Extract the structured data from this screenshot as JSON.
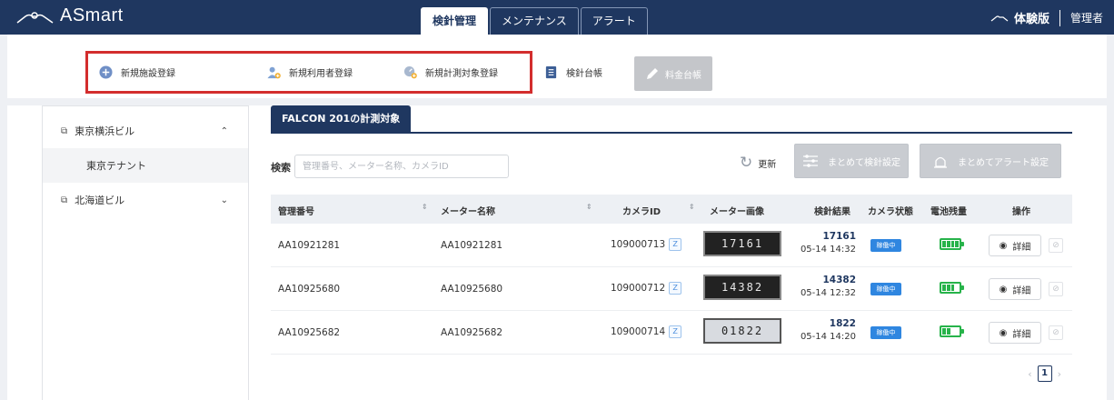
{
  "header": {
    "brand": "ASmart",
    "tabs": [
      {
        "label": "検針管理"
      },
      {
        "label": "メンテナンス"
      },
      {
        "label": "アラート"
      }
    ],
    "trial_label": "体験版",
    "user_label": "管理者"
  },
  "toolbar": {
    "items": [
      {
        "label": "新規施設登録",
        "icon": "plus-circle-icon"
      },
      {
        "label": "新規利用者登録",
        "icon": "user-add-icon"
      },
      {
        "label": "新規計測対象登録",
        "icon": "meter-add-icon"
      },
      {
        "label": "検針台帳",
        "icon": "ledger-icon"
      }
    ],
    "disabled_label": "料金台帳"
  },
  "sidebar": {
    "items": [
      {
        "label": "東京横浜ビル",
        "expanded": true
      },
      {
        "label": "東京テナント"
      },
      {
        "label": "北海道ビル",
        "expanded": false
      }
    ]
  },
  "main": {
    "tab_label": "FALCON 201の計測対象",
    "search_label": "検索",
    "search_placeholder": "管理番号、メーター名称、カメラID",
    "refresh_label": "更新",
    "batch_reading_label": "まとめて検針設定",
    "batch_alert_label": "まとめてアラート設定",
    "columns": [
      "管理番号",
      "メーター名称",
      "カメラID",
      "メーター画像",
      "検針結果",
      "カメラ状態",
      "電池残量",
      "操作"
    ],
    "rows": [
      {
        "id": "AA10921281",
        "name": "AA10921281",
        "camera_id": "109000713",
        "z": "Z",
        "meter_text": "17161",
        "value": "17161",
        "time": "05-14 14:32",
        "status": "稼働中",
        "battery_level": 4,
        "detail": "詳細"
      },
      {
        "id": "AA10925680",
        "name": "AA10925680",
        "camera_id": "109000712",
        "z": "Z",
        "meter_text": "14382",
        "value": "14382",
        "time": "05-14 12:32",
        "status": "稼働中",
        "battery_level": 3,
        "detail": "詳細"
      },
      {
        "id": "AA10925682",
        "name": "AA10925682",
        "camera_id": "109000714",
        "z": "Z",
        "meter_text": "01822",
        "value": "1822",
        "time": "05-14 14:20",
        "status": "稼働中",
        "battery_level": 2,
        "detail": "詳細"
      }
    ],
    "pagination": {
      "current": "1"
    }
  },
  "colors": {
    "header_bg": "#1f3760",
    "accent_red": "#d32d2d",
    "status_blue": "#2f86e0",
    "battery_green": "#27b34a"
  }
}
